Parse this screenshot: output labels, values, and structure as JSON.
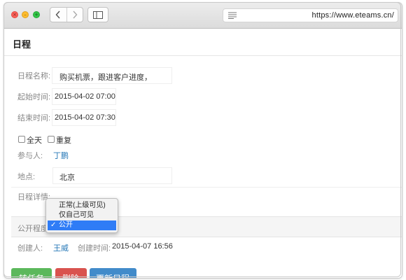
{
  "browser": {
    "url": "https://www.eteams.cn/",
    "traffic_lights": {
      "close_glyph": "×",
      "minimize_glyph": "–",
      "zoom_glyph": "+"
    },
    "nav": {
      "back_icon": "chevron-left-icon",
      "forward_icon": "chevron-right-icon",
      "sidebar_icon": "sidebar-icon",
      "reader_icon": "reader-icon"
    }
  },
  "page": {
    "title": "日程",
    "form": {
      "name": {
        "label": "日程名称:",
        "value": "购买机票，跟进客户进度，"
      },
      "start": {
        "label": "起始时间:",
        "value": "2015-04-02 07:00"
      },
      "end": {
        "label": "结束时间:",
        "value": "2015-04-02 07:30"
      },
      "allday": {
        "label": "全天",
        "checked": false
      },
      "repeat": {
        "label": "重复",
        "checked": false
      },
      "participants": {
        "label": "参与人:",
        "value": "丁鹏"
      },
      "location": {
        "label": "地点:",
        "value": "北京"
      },
      "details": {
        "label": "日程详情:",
        "value": ""
      },
      "visibility": {
        "label": "公开程度",
        "options": [
          "正常(上级可见)",
          "仅自己可见",
          "公开"
        ],
        "selected": "公开",
        "check_glyph": "✓"
      },
      "creator": {
        "label": "创建人:",
        "value": "王威"
      },
      "created_time": {
        "label": "创建时间:",
        "value": "2015-04-07 16:56"
      }
    },
    "buttons": {
      "to_task": "转任务",
      "delete": "删除",
      "update": "更新日程"
    },
    "colors": {
      "green": "#5cb85c",
      "red": "#d9534f",
      "blue": "#428bca",
      "link": "#2a7ab8",
      "selection": "#2f7cf6"
    }
  }
}
